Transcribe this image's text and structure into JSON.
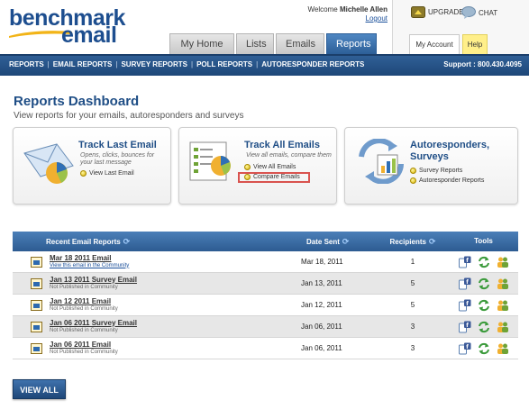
{
  "header": {
    "logo_line1": "benchmark",
    "logo_line2": "email",
    "welcome_prefix": "Welcome ",
    "user_name": "Michelle Allen",
    "logout": "Logout",
    "tabs": [
      {
        "label": "My Home"
      },
      {
        "label": "Lists"
      },
      {
        "label": "Emails"
      },
      {
        "label": "Reports"
      }
    ],
    "upgrade": "UPGRADE",
    "chat": "CHAT",
    "my_account": "My Account",
    "help": "Help"
  },
  "nav": {
    "items": [
      {
        "label": "REPORTS"
      },
      {
        "label": "EMAIL REPORTS"
      },
      {
        "label": "SURVEY REPORTS"
      },
      {
        "label": "POLL REPORTS"
      },
      {
        "label": "AUTORESPONDER REPORTS"
      }
    ],
    "support": "Support : 800.430.4095"
  },
  "dashboard": {
    "title": "Reports Dashboard",
    "subtitle": "View reports for your emails, autoresponders and surveys"
  },
  "cards": {
    "last_email": {
      "title": "Track Last Email",
      "desc": "Opens, clicks, bounces for your last message",
      "link": "View Last Email"
    },
    "all_emails": {
      "title": "Track All Emails",
      "desc": "View all emails, compare them",
      "link1": "View All Emails",
      "link2": "Compare Emails"
    },
    "autoresponders": {
      "title_line1": "Autoresponders,",
      "title_line2": "Surveys",
      "link1": "Survey Reports",
      "link2": "Autoresponder Reports"
    }
  },
  "table": {
    "headers": {
      "name": "Recent Email Reports",
      "date": "Date Sent",
      "recipients": "Recipients",
      "tools": "Tools"
    },
    "rows": [
      {
        "title": "Mar 18 2011 Email",
        "sub": "View this email in the Community",
        "date": "Mar 18, 2011",
        "recipients": "1"
      },
      {
        "title": "Jan 13 2011 Survey Email",
        "sub": "Not Published in Community",
        "date": "Jan 13, 2011",
        "recipients": "5"
      },
      {
        "title": "Jan 12 2011 Email",
        "sub": "Not Published in Community",
        "date": "Jan 12, 2011",
        "recipients": "5"
      },
      {
        "title": "Jan 06 2011 Survey Email",
        "sub": "Not Published in Community",
        "date": "Jan 06, 2011",
        "recipients": "3"
      },
      {
        "title": "Jan 06 2011 Email",
        "sub": "Not Published in Community",
        "date": "Jan 06, 2011",
        "recipients": "3"
      }
    ]
  },
  "view_all": "VIEW ALL",
  "colors": {
    "brand_blue": "#1f4e86",
    "nav_blue": "#1e4778",
    "highlight_red": "#d9534f",
    "help_yellow": "#ffef8a"
  }
}
